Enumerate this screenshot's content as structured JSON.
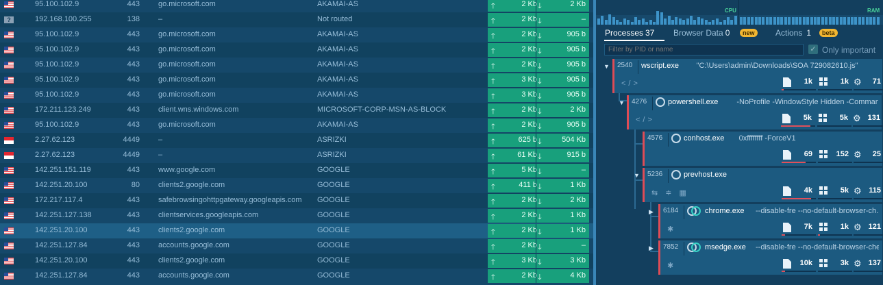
{
  "connections": [
    {
      "flag": "us",
      "ip": "95.100.102.9",
      "port": "443",
      "domain": "go.microsoft.com",
      "asn": "AKAMAI-AS",
      "up": "2 Kb",
      "down": "2 Kb"
    },
    {
      "flag": "unknown",
      "ip": "192.168.100.255",
      "port": "138",
      "domain": "–",
      "asn": "Not routed",
      "up": "2 Kb",
      "down": "–"
    },
    {
      "flag": "us",
      "ip": "95.100.102.9",
      "port": "443",
      "domain": "go.microsoft.com",
      "asn": "AKAMAI-AS",
      "up": "2 Kb",
      "down": "905 b"
    },
    {
      "flag": "us",
      "ip": "95.100.102.9",
      "port": "443",
      "domain": "go.microsoft.com",
      "asn": "AKAMAI-AS",
      "up": "2 Kb",
      "down": "905 b"
    },
    {
      "flag": "us",
      "ip": "95.100.102.9",
      "port": "443",
      "domain": "go.microsoft.com",
      "asn": "AKAMAI-AS",
      "up": "2 Kb",
      "down": "905 b"
    },
    {
      "flag": "us",
      "ip": "95.100.102.9",
      "port": "443",
      "domain": "go.microsoft.com",
      "asn": "AKAMAI-AS",
      "up": "3 Kb",
      "down": "905 b"
    },
    {
      "flag": "us",
      "ip": "95.100.102.9",
      "port": "443",
      "domain": "go.microsoft.com",
      "asn": "AKAMAI-AS",
      "up": "3 Kb",
      "down": "905 b"
    },
    {
      "flag": "us",
      "ip": "172.211.123.249",
      "port": "443",
      "domain": "client.wns.windows.com",
      "asn": "MICROSOFT-CORP-MSN-AS-BLOCK",
      "up": "2 Kb",
      "down": "2 Kb"
    },
    {
      "flag": "us",
      "ip": "95.100.102.9",
      "port": "443",
      "domain": "go.microsoft.com",
      "asn": "AKAMAI-AS",
      "up": "2 Kb",
      "down": "905 b"
    },
    {
      "flag": "id",
      "ip": "2.27.62.123",
      "port": "4449",
      "domain": "–",
      "asn": "ASRIZKI",
      "up": "625 b",
      "down": "504 Kb"
    },
    {
      "flag": "id",
      "ip": "2.27.62.123",
      "port": "4449",
      "domain": "–",
      "asn": "ASRIZKI",
      "up": "61 Kb",
      "down": "915 b"
    },
    {
      "flag": "us",
      "ip": "142.251.151.119",
      "port": "443",
      "domain": "www.google.com",
      "asn": "GOOGLE",
      "up": "5 Kb",
      "down": "–"
    },
    {
      "flag": "us",
      "ip": "142.251.20.100",
      "port": "80",
      "domain": "clients2.google.com",
      "asn": "GOOGLE",
      "up": "411 b",
      "down": "1 Kb"
    },
    {
      "flag": "us",
      "ip": "172.217.117.4",
      "port": "443",
      "domain": "safebrowsingohttpgateway.googleapis.com",
      "asn": "GOOGLE",
      "up": "2 Kb",
      "down": "2 Kb"
    },
    {
      "flag": "us",
      "ip": "142.251.127.138",
      "port": "443",
      "domain": "clientservices.googleapis.com",
      "asn": "GOOGLE",
      "up": "2 Kb",
      "down": "1 Kb"
    },
    {
      "flag": "us",
      "ip": "142.251.20.100",
      "port": "443",
      "domain": "clients2.google.com",
      "asn": "GOOGLE",
      "up": "2 Kb",
      "down": "1 Kb"
    },
    {
      "flag": "us",
      "ip": "142.251.127.84",
      "port": "443",
      "domain": "accounts.google.com",
      "asn": "GOOGLE",
      "up": "2 Kb",
      "down": "–"
    },
    {
      "flag": "us",
      "ip": "142.251.20.100",
      "port": "443",
      "domain": "clients2.google.com",
      "asn": "GOOGLE",
      "up": "3 Kb",
      "down": "3 Kb"
    },
    {
      "flag": "us",
      "ip": "142.251.127.84",
      "port": "443",
      "domain": "accounts.google.com",
      "asn": "GOOGLE",
      "up": "2 Kb",
      "down": "4 Kb"
    }
  ],
  "selected_row": 15,
  "graphs": {
    "cpu_label": "CPU",
    "ram_label": "RAM",
    "cpu_levels": [
      0.4,
      0.6,
      0.3,
      0.7,
      0.5,
      0.3,
      0.2,
      0.4,
      0.3,
      0.2,
      0.5,
      0.3,
      0.4,
      0.2,
      0.3,
      0.2,
      0.9,
      0.8,
      0.4,
      0.6,
      0.3,
      0.5,
      0.4,
      0.3,
      0.4,
      0.6,
      0.3,
      0.5,
      0.4,
      0.3,
      0.2,
      0.3,
      0.4,
      0.2,
      0.3,
      0.5,
      0.3,
      0.6
    ],
    "ram_levels": [
      0.5,
      0.5,
      0.5,
      0.5,
      0.5,
      0.5,
      0.5,
      0.5,
      0.5,
      0.5,
      0.5,
      0.5,
      0.5,
      0.5,
      0.5,
      0.5,
      0.5,
      0.5,
      0.5,
      0.5,
      0.5,
      0.5,
      0.5,
      0.5,
      0.5,
      0.5,
      0.5,
      0.5,
      0.5,
      0.5,
      0.5,
      0.5,
      0.5,
      0.5,
      0.5,
      0.5,
      0.5,
      0.5
    ]
  },
  "tabs": [
    {
      "label": "Processes",
      "count": "37",
      "badge": ""
    },
    {
      "label": "Browser Data",
      "count": "0",
      "badge": "new"
    },
    {
      "label": "Actions",
      "count": "1",
      "badge": "beta"
    }
  ],
  "filter": {
    "placeholder": "Filter by PID or name",
    "only_important_label": "Only important",
    "checkmark": "✓"
  },
  "processes": [
    {
      "pid": "2540",
      "name": "wscript.exe",
      "args": "\"C:\\Users\\admin\\Downloads\\SOA 729082610.js\"",
      "icons": "</>",
      "files": "1k",
      "regs": "1k",
      "threads": "71",
      "files_level": 0.05,
      "regs_level": 0.0,
      "threads_level": 0.0
    },
    {
      "pid": "4276",
      "name": "powershell.exe",
      "args": "-NoProfile -WindowStyle Hidden -Command…",
      "icons": "</>",
      "files": "5k",
      "regs": "5k",
      "threads": "131",
      "files_level": 0.85,
      "regs_level": 0.0,
      "threads_level": 0.0
    },
    {
      "pid": "4576",
      "name": "conhost.exe",
      "args": "0xffffffff -ForceV1",
      "icons": "",
      "files": "69",
      "regs": "152",
      "threads": "25",
      "files_level": 0.7,
      "regs_level": 0.0,
      "threads_level": 0.0
    },
    {
      "pid": "5236",
      "name": "prevhost.exe",
      "args": "",
      "icons": "⇆ ≑ ▦",
      "files": "4k",
      "regs": "5k",
      "threads": "115",
      "files_level": 0.85,
      "regs_level": 0.0,
      "threads_level": 0.0
    },
    {
      "pid": "6184",
      "name": "chrome.exe",
      "args": "--disable-fre --no-default-browser-ch…",
      "icons": "✱",
      "files": "7k",
      "regs": "1k",
      "threads": "121",
      "files_level": 0.1,
      "regs_level": 0.05,
      "threads_level": 0.0
    },
    {
      "pid": "7852",
      "name": "msedge.exe",
      "args": "--disable-fre --no-default-browser-che…",
      "icons": "✱",
      "files": "10k",
      "regs": "3k",
      "threads": "137",
      "files_level": 0.1,
      "regs_level": 0.0,
      "threads_level": 0.0
    }
  ],
  "expander_icons": {
    "expanded": "▼",
    "collapsed": "▶"
  },
  "arrows": {
    "up": "🡑",
    "down": "🡓",
    "gear": "⚙"
  }
}
